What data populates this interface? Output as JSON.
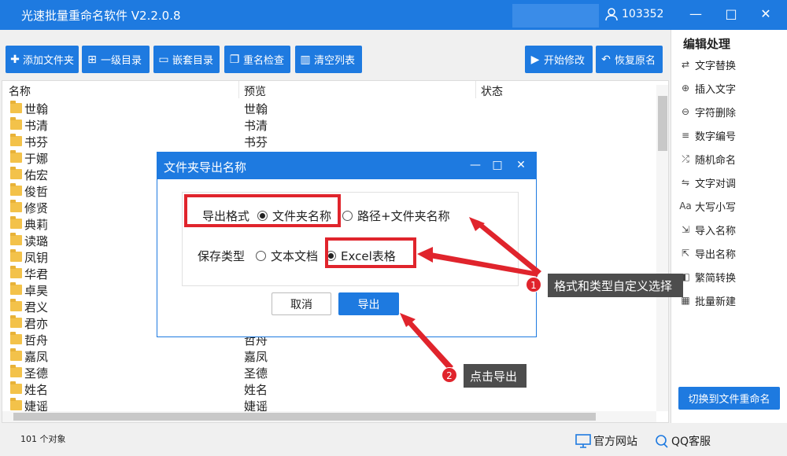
{
  "app": {
    "title": "光速批量重命名软件 V2.2.0.8",
    "user_id": "103352",
    "colors": {
      "accent": "#1e7ae0",
      "highlight": "#e0242c",
      "callout": "#4d4d4d"
    }
  },
  "toolbar": {
    "add_folder": "添加文件夹",
    "level1_dir": "一级目录",
    "nested_dir": "嵌套目录",
    "rename_check": "重名检查",
    "clear_list": "清空列表",
    "start_modify": "开始修改",
    "restore_names": "恢复原名"
  },
  "list": {
    "headers": [
      "名称",
      "预览",
      "状态"
    ],
    "rows": [
      {
        "name": "世翰",
        "preview": "世翰"
      },
      {
        "name": "书清",
        "preview": "书清"
      },
      {
        "name": "书芬",
        "preview": "书芬"
      },
      {
        "name": "于娜",
        "preview": ""
      },
      {
        "name": "佑宏",
        "preview": ""
      },
      {
        "name": "俊哲",
        "preview": ""
      },
      {
        "name": "修贤",
        "preview": ""
      },
      {
        "name": "典莉",
        "preview": ""
      },
      {
        "name": "读璐",
        "preview": ""
      },
      {
        "name": "凤钥",
        "preview": ""
      },
      {
        "name": "华君",
        "preview": ""
      },
      {
        "name": "卓昊",
        "preview": ""
      },
      {
        "name": "君义",
        "preview": ""
      },
      {
        "name": "君亦",
        "preview": ""
      },
      {
        "name": "哲舟",
        "preview": "哲舟"
      },
      {
        "name": "嘉凤",
        "preview": "嘉凤"
      },
      {
        "name": "圣德",
        "preview": "圣德"
      },
      {
        "name": "姓名",
        "preview": "姓名"
      },
      {
        "name": "婕谣",
        "preview": "婕谣"
      }
    ]
  },
  "panel": {
    "title": "编辑处理",
    "items": [
      {
        "label": "文字替换",
        "icon": "replace-icon"
      },
      {
        "label": "插入文字",
        "icon": "insert-icon"
      },
      {
        "label": "字符删除",
        "icon": "delete-char-icon"
      },
      {
        "label": "数字编号",
        "icon": "number-icon"
      },
      {
        "label": "随机命名",
        "icon": "shuffle-icon"
      },
      {
        "label": "文字对调",
        "icon": "swap-icon"
      },
      {
        "label": "大写小写",
        "icon": "case-icon"
      },
      {
        "label": "导入名称",
        "icon": "import-icon"
      },
      {
        "label": "导出名称",
        "icon": "export-icon"
      },
      {
        "label": "繁简转换",
        "icon": "convert-icon"
      },
      {
        "label": "批量新建",
        "icon": "new-batch-icon"
      }
    ],
    "switch_button": "切换到文件重命名"
  },
  "status": {
    "count": "101 个对象",
    "website": "官方网站",
    "qq": "QQ客服"
  },
  "dialog": {
    "title": "文件夹导出名称",
    "format_label": "导出格式",
    "format_options": [
      "文件夹名称",
      "路径+文件夹名称"
    ],
    "format_selected": "文件夹名称",
    "type_label": "保存类型",
    "type_options": [
      "文本文档",
      "Excel表格"
    ],
    "type_selected": "Excel表格",
    "cancel": "取消",
    "export": "导出"
  },
  "callouts": [
    {
      "number": "1",
      "text": "格式和类型自定义选择"
    },
    {
      "number": "2",
      "text": "点击导出"
    }
  ]
}
